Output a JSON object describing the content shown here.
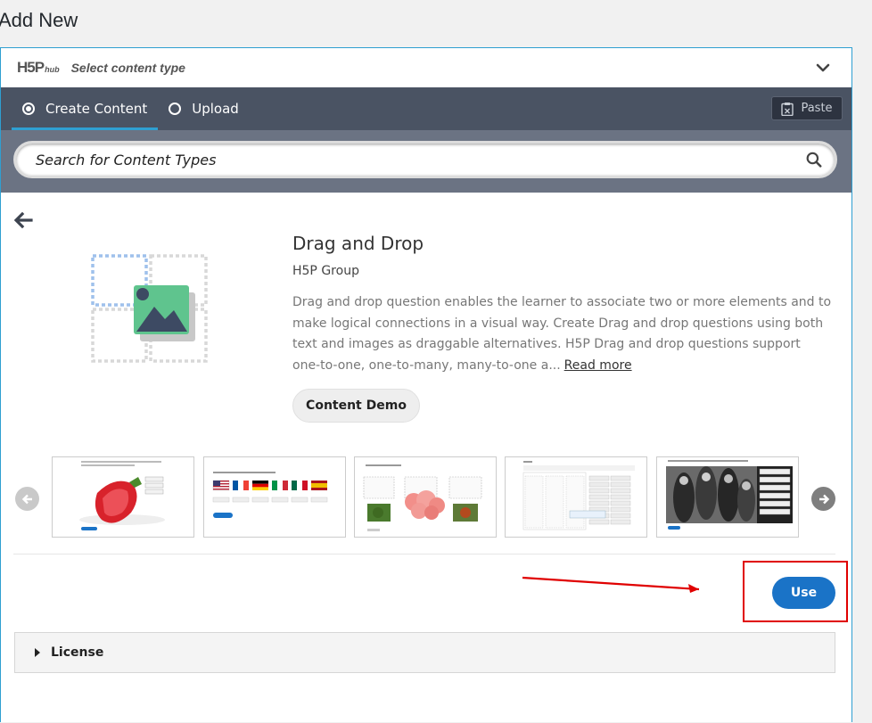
{
  "page": {
    "title": "Add New"
  },
  "hub": {
    "logo_main": "H5P",
    "logo_sub": "hub",
    "header_title": "Select content type"
  },
  "nav": {
    "tabs": [
      {
        "label": "Create Content",
        "active": true
      },
      {
        "label": "Upload",
        "active": false
      }
    ],
    "paste_label": "Paste"
  },
  "search": {
    "placeholder": "Search for Content Types"
  },
  "content_type": {
    "title": "Drag and Drop",
    "owner": "H5P Group",
    "description": "Drag and drop question enables the learner to associate two or more elements and to make logical connections in a visual way. Create Drag and drop questions using both text and images as draggable alternatives. H5P Drag and drop questions support one-to-one, one-to-many, many-to-one a...",
    "read_more": "Read more",
    "demo_label": "Content Demo",
    "use_label": "Use"
  },
  "license": {
    "label": "License"
  },
  "colors": {
    "accent": "#2f9fd1",
    "nav_bg": "#4a5363",
    "search_bg": "#6b7383",
    "use_button": "#1a73c7",
    "annotation": "#e00000"
  }
}
